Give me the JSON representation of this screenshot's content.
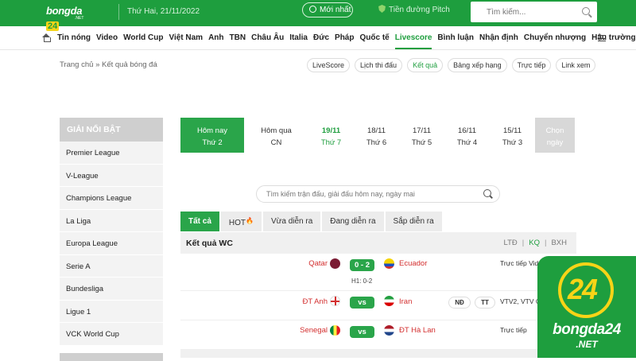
{
  "header": {
    "logo_text": "bongda",
    "logo_num": "24",
    "logo_net": ".NET",
    "date": "Thứ Hai, 21/11/2022",
    "newest_label": "Mới nhất",
    "pitch_label": "Tiền đường Pitch",
    "search_placeholder": "Tìm kiếm..."
  },
  "nav": {
    "items": [
      "Tin nóng",
      "Video",
      "World Cup",
      "Việt Nam",
      "Anh",
      "TBN",
      "Châu Âu",
      "Italia",
      "Đức",
      "Pháp",
      "Quốc tế",
      "Livescore",
      "Bình luận",
      "Nhận định",
      "Chuyển nhượng",
      "Hậu trường"
    ],
    "active_index": 11
  },
  "breadcrumb": {
    "home": "Trang chủ",
    "sep": "»",
    "current": "Kết quả bóng đá"
  },
  "chips": [
    "LiveScore",
    "Lịch thi đấu",
    "Kết quả",
    "Bảng xếp hạng",
    "Trực tiếp",
    "Link xem"
  ],
  "chips_active": 2,
  "sidebar": {
    "title": "GIẢI NỔI BẬT",
    "items": [
      "Premier League",
      "V-League",
      "Champions League",
      "La Liga",
      "Europa League",
      "Serie A",
      "Bundesliga",
      "Ligue 1",
      "VCK World Cup"
    ]
  },
  "days": [
    {
      "d": "Hôm nay",
      "w": "Thứ 2"
    },
    {
      "d": "Hôm qua",
      "w": "CN"
    },
    {
      "d": "19/11",
      "w": "Thứ 7"
    },
    {
      "d": "18/11",
      "w": "Thứ 6"
    },
    {
      "d": "17/11",
      "w": "Thứ 5"
    },
    {
      "d": "16/11",
      "w": "Thứ 4"
    },
    {
      "d": "15/11",
      "w": "Thứ 3"
    },
    {
      "d": "Chọn",
      "w": "ngày"
    }
  ],
  "match_search_placeholder": "Tìm kiếm trận đấu, giải đấu hôm nay, ngày mai",
  "tabs": [
    "Tất cả",
    "HOT",
    "Vừa diễn ra",
    "Đang diễn ra",
    "Sắp diễn ra"
  ],
  "competition": {
    "title": "Kết quả WC",
    "links": [
      "LTĐ",
      "KQ",
      "BXH"
    ]
  },
  "matches": [
    {
      "home": "Qatar",
      "away": "Ecuador",
      "score": "0 - 2",
      "ht": "H1: 0-2",
      "tv": "Trực tiếp",
      "tv2": "Vide"
    },
    {
      "home": "ĐT Anh",
      "away": "Iran",
      "score": "vs",
      "odd1": "NĐ",
      "odd2": "TT",
      "tv": "VTV2, VTV C"
    },
    {
      "home": "Senegal",
      "away": "ĐT Hà Lan",
      "score": "vs",
      "tv": "Trực tiếp"
    }
  ],
  "badge": {
    "num": "24",
    "brand": "bongda24",
    "net": ".NET"
  },
  "colors": {
    "brand_green": "#1e9e3e",
    "accent_yellow": "#f7d417",
    "team_red": "#d32f2f"
  }
}
